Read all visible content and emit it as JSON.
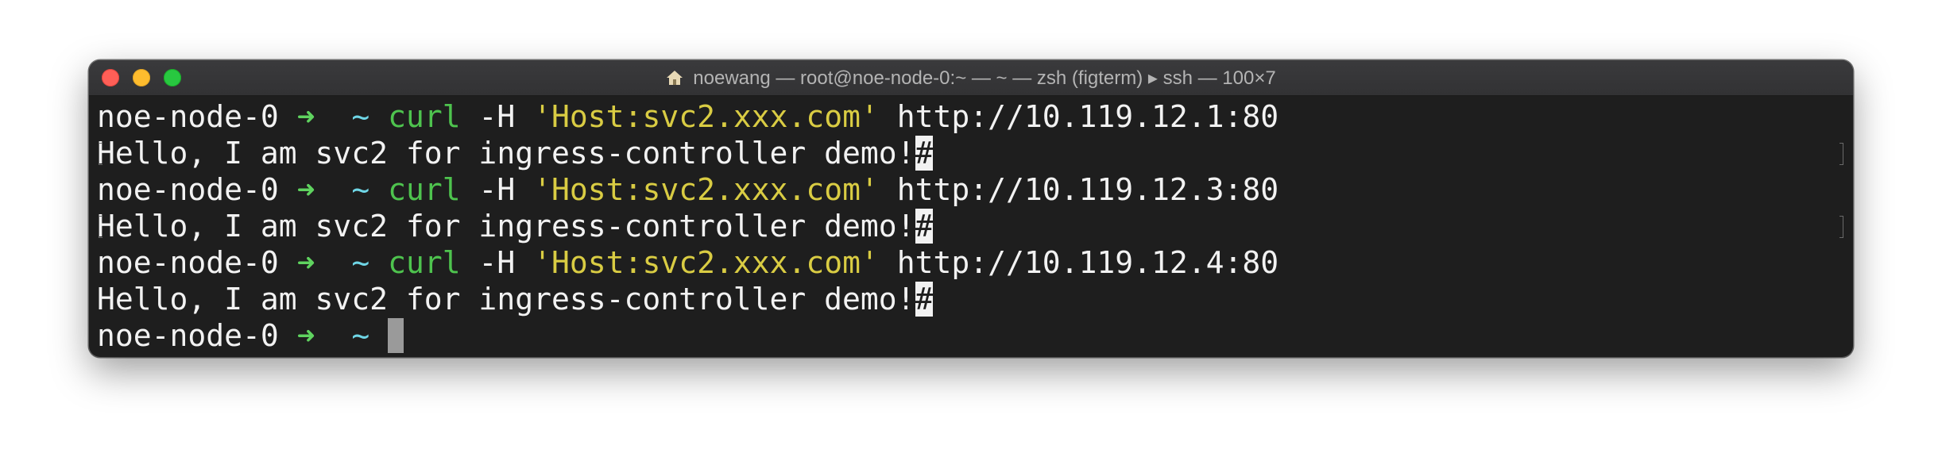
{
  "window": {
    "title": "noewang — root@noe-node-0:~ — ~ — zsh (figterm) ▸ ssh — 100×7",
    "colors": {
      "background": "#1e1e1e",
      "text": "#f2f2f2",
      "prompt_arrow": "#5fd35f",
      "tilde": "#6fd6e6",
      "command": "#4ec34e",
      "string": "#d9cc43"
    }
  },
  "terminal": {
    "lines": [
      {
        "host": "noe-node-0",
        "arrow": "➜",
        "dir": "~",
        "cmd": "curl",
        "flag": "-H",
        "arg": "'Host:svc2.xxx.com'",
        "url": "http://10.119.12.1:80"
      },
      {
        "output": "Hello, I am svc2 for ingress-controller demo!",
        "eol": "#"
      },
      {
        "host": "noe-node-0",
        "arrow": "➜",
        "dir": "~",
        "cmd": "curl",
        "flag": "-H",
        "arg": "'Host:svc2.xxx.com'",
        "url": "http://10.119.12.3:80"
      },
      {
        "output": "Hello, I am svc2 for ingress-controller demo!",
        "eol": "#"
      },
      {
        "host": "noe-node-0",
        "arrow": "➜",
        "dir": "~",
        "cmd": "curl",
        "flag": "-H",
        "arg": "'Host:svc2.xxx.com'",
        "url": "http://10.119.12.4:80"
      },
      {
        "output": "Hello, I am svc2 for ingress-controller demo!",
        "eol": "#"
      },
      {
        "host": "noe-node-0",
        "arrow": "➜",
        "dir": "~"
      }
    ]
  }
}
